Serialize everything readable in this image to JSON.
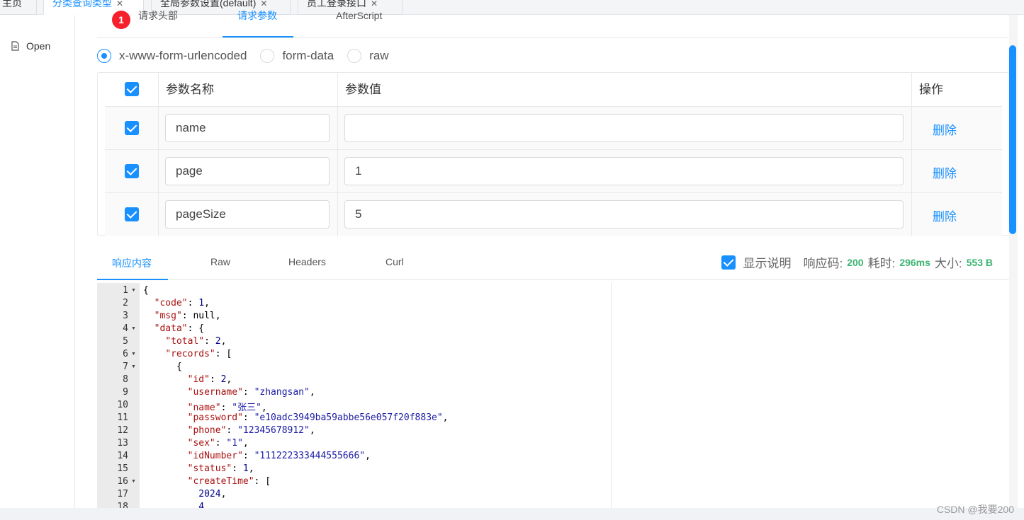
{
  "top_tabs": [
    {
      "label": "主页",
      "closable": false
    },
    {
      "label": "分类查询类型",
      "closable": true,
      "active": true
    },
    {
      "label": "全局参数设置(default)",
      "closable": true
    },
    {
      "label": "员工登录接口",
      "closable": true
    }
  ],
  "sidebar": {
    "open_label": "Open"
  },
  "request_tabs": [
    {
      "label": "请求头部",
      "badge": "1"
    },
    {
      "label": "请求参数",
      "active": true
    },
    {
      "label": "AfterScript"
    }
  ],
  "body_types": [
    {
      "label": "x-www-form-urlencoded",
      "checked": true
    },
    {
      "label": "form-data",
      "checked": false
    },
    {
      "label": "raw",
      "checked": false
    }
  ],
  "param_table": {
    "headers": {
      "name": "参数名称",
      "value": "参数值",
      "action": "操作"
    },
    "rows": [
      {
        "name": "name",
        "value": "",
        "action": "删除"
      },
      {
        "name": "page",
        "value": "1",
        "action": "删除"
      },
      {
        "name": "pageSize",
        "value": "5",
        "action": "删除"
      }
    ]
  },
  "response_tabs": [
    {
      "label": "响应内容",
      "active": true
    },
    {
      "label": "Raw"
    },
    {
      "label": "Headers"
    },
    {
      "label": "Curl"
    }
  ],
  "response_info": {
    "show_desc_label": "显示说明",
    "code_label": "响应码:",
    "code_value": "200",
    "time_label": "耗时:",
    "time_value": "296ms",
    "size_label": "大小:",
    "size_value": "553 B"
  },
  "code_lines": [
    {
      "n": "1",
      "fold": true,
      "text": "{"
    },
    {
      "n": "2",
      "fold": false,
      "text": "  \"code\": 1,"
    },
    {
      "n": "3",
      "fold": false,
      "text": "  \"msg\": null,"
    },
    {
      "n": "4",
      "fold": true,
      "text": "  \"data\": {"
    },
    {
      "n": "5",
      "fold": false,
      "text": "    \"total\": 2,"
    },
    {
      "n": "6",
      "fold": true,
      "text": "    \"records\": ["
    },
    {
      "n": "7",
      "fold": true,
      "text": "      {"
    },
    {
      "n": "8",
      "fold": false,
      "text": "        \"id\": 2,"
    },
    {
      "n": "9",
      "fold": false,
      "text": "        \"username\": \"zhangsan\","
    },
    {
      "n": "10",
      "fold": false,
      "text": "        \"name\": \"张三\","
    },
    {
      "n": "11",
      "fold": false,
      "text": "        \"password\": \"e10adc3949ba59abbe56e057f20f883e\","
    },
    {
      "n": "12",
      "fold": false,
      "text": "        \"phone\": \"12345678912\","
    },
    {
      "n": "13",
      "fold": false,
      "text": "        \"sex\": \"1\","
    },
    {
      "n": "14",
      "fold": false,
      "text": "        \"idNumber\": \"111222333444555666\","
    },
    {
      "n": "15",
      "fold": false,
      "text": "        \"status\": 1,"
    },
    {
      "n": "16",
      "fold": true,
      "text": "        \"createTime\": ["
    },
    {
      "n": "17",
      "fold": false,
      "text": "          2024,"
    },
    {
      "n": "18",
      "fold": false,
      "text": "          4,"
    }
  ],
  "watermark": "CSDN @我要200",
  "colors": {
    "accent": "#1890ff",
    "success": "#3cb371",
    "badge": "#f5222d"
  }
}
